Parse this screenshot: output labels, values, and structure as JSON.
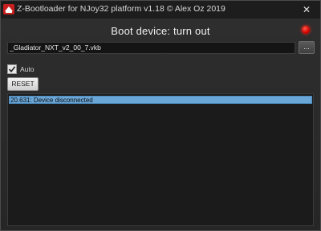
{
  "window": {
    "title": "Z-Bootloader for NJoy32 platform v1.18 © Alex Oz 2019",
    "close_glyph": "✕"
  },
  "status": {
    "heading": "Boot device: turn out",
    "indicator_color": "#e00000"
  },
  "file": {
    "path_value": "_Gladiator_NXT_v2_00_7.vkb",
    "browse_label": "..."
  },
  "options": {
    "auto_label": "Auto",
    "auto_checked": true
  },
  "actions": {
    "reset_label": "RESET"
  },
  "log": {
    "entries": [
      {
        "text": "20.631: Device disconnected",
        "selected": true
      }
    ]
  },
  "colors": {
    "accent_selection": "#6aa6d6",
    "background": "#2b2b2b"
  }
}
